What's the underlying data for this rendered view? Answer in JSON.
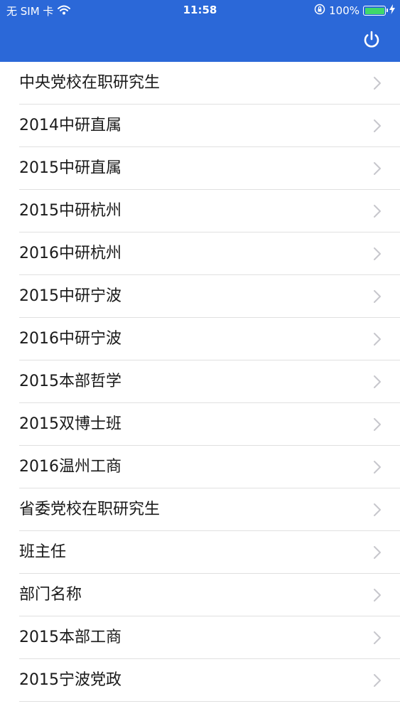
{
  "status_bar": {
    "carrier": "无 SIM 卡",
    "time": "11:58",
    "battery": "100%",
    "battery_level": 1.0
  },
  "header": {
    "power_icon": "power-icon"
  },
  "list": {
    "items": [
      {
        "label": "中央党校在职研究生"
      },
      {
        "label": "2014中研直属"
      },
      {
        "label": "2015中研直属"
      },
      {
        "label": "2015中研杭州"
      },
      {
        "label": "2016中研杭州"
      },
      {
        "label": "2015中研宁波"
      },
      {
        "label": "2016中研宁波"
      },
      {
        "label": "2015本部哲学"
      },
      {
        "label": "2015双博士班"
      },
      {
        "label": "2016温州工商"
      },
      {
        "label": "省委党校在职研究生"
      },
      {
        "label": "班主任"
      },
      {
        "label": "部门名称"
      },
      {
        "label": "2015本部工商"
      },
      {
        "label": "2015宁波党政"
      }
    ]
  },
  "colors": {
    "header_bg": "#2b68d8",
    "divider": "#e0e0e0",
    "chevron": "#c7c7cc",
    "battery_fill": "#3fd86b"
  }
}
